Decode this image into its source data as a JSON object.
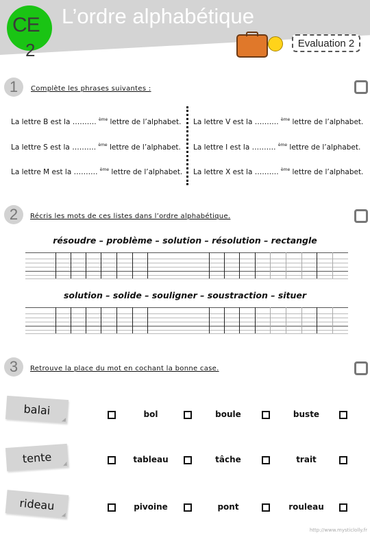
{
  "header": {
    "level_badge_top": "CE",
    "level_badge_bottom": "2",
    "title": "L’ordre alphabétique",
    "evaluation_label": "Evaluation 2",
    "illustration_icons": [
      "suitcase-icon",
      "chick-icon"
    ]
  },
  "exercise1": {
    "number": "1",
    "instruction": "Complète les phrases suivantes :",
    "sentences_left": [
      {
        "prefix": "La lettre B  est la",
        "blank": "……….",
        "sup": "ème",
        "suffix": "lettre de l’alphabet."
      },
      {
        "prefix": "La lettre S  est la",
        "blank": "……….",
        "sup": "ème",
        "suffix": "lettre de l’alphabet."
      },
      {
        "prefix": "La lettre M  est la",
        "blank": "……….",
        "sup": "ème",
        "suffix": "lettre de l’alphabet."
      }
    ],
    "sentences_right": [
      {
        "prefix": "La lettre V  est la",
        "blank": "……….",
        "sup": "ème",
        "suffix": "lettre de l’alphabet."
      },
      {
        "prefix": "La lettre I  est la",
        "blank": "……….",
        "sup": "ème",
        "suffix": "lettre de l’alphabet."
      },
      {
        "prefix": "La lettre X  est la",
        "blank": "……….",
        "sup": "ème",
        "suffix": "lettre de l’alphabet."
      }
    ]
  },
  "exercise2": {
    "number": "2",
    "instruction": "Récris les mots de ces listes dans l’ordre alphabétique.",
    "lists": [
      "résoudre – problème – solution – résolution – rectangle",
      "solution – solide – souligner – soustraction – situer"
    ]
  },
  "exercise3": {
    "number": "3",
    "instruction": "Retrouve la place du mot en cochant la bonne case.",
    "rows": [
      {
        "word": "balai",
        "choices": [
          "bol",
          "boule",
          "buste"
        ]
      },
      {
        "word": "tente",
        "choices": [
          "tableau",
          "tâche",
          "trait"
        ]
      },
      {
        "word": "rideau",
        "choices": [
          "pivoine",
          "pont",
          "rouleau"
        ]
      }
    ]
  },
  "footer": {
    "url": "http://www.mysticlolly.fr"
  },
  "colors": {
    "header_band": "#d4d4d4",
    "level_badge": "#1ac414",
    "number_circle": "#d2d2d2"
  }
}
